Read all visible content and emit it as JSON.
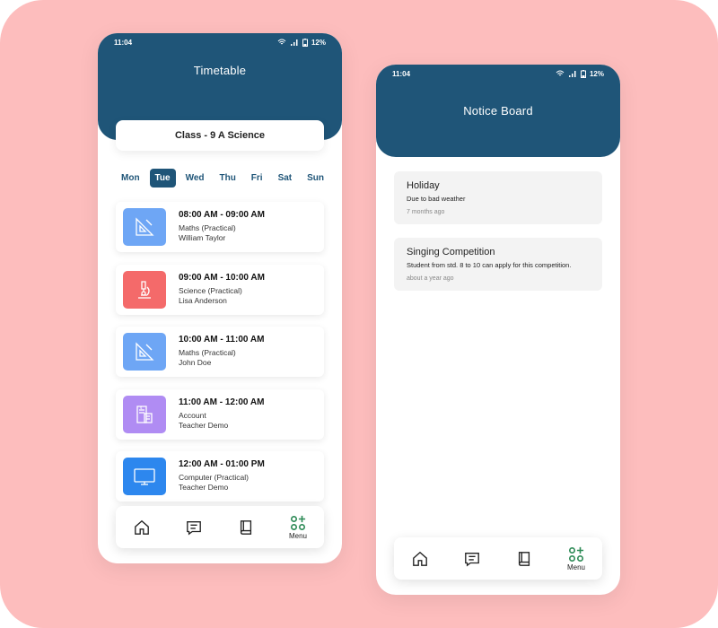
{
  "status_bar": {
    "time": "11:04",
    "battery": "12%"
  },
  "timetable": {
    "title": "Timetable",
    "class_name": "Class - 9 A Science",
    "days": [
      "Mon",
      "Tue",
      "Wed",
      "Thu",
      "Fri",
      "Sat",
      "Sun"
    ],
    "selected_day": "Tue",
    "periods": [
      {
        "time": "08:00 AM - 09:00 AM",
        "subject": "Maths (Practical)",
        "teacher": "William Taylor",
        "icon": "ruler-triangle-icon",
        "color": "#6ea6f5"
      },
      {
        "time": "09:00 AM - 10:00 AM",
        "subject": "Science (Practical)",
        "teacher": "Lisa Anderson",
        "icon": "microscope-icon",
        "color": "#f46a6a"
      },
      {
        "time": "10:00 AM - 11:00 AM",
        "subject": "Maths (Practical)",
        "teacher": "John Doe",
        "icon": "ruler-triangle-icon",
        "color": "#6ea6f5"
      },
      {
        "time": "11:00 AM - 12:00 AM",
        "subject": "Account",
        "teacher": "Teacher Demo",
        "icon": "calculator-document-icon",
        "color": "#b08cf3"
      },
      {
        "time": "12:00 AM - 01:00 PM",
        "subject": "Computer (Practical)",
        "teacher": "Teacher Demo",
        "icon": "monitor-icon",
        "color": "#2d87ee"
      }
    ]
  },
  "notice_board": {
    "title": "Notice Board",
    "notices": [
      {
        "title": "Holiday",
        "body": "Due to bad weather",
        "time": "7 months ago"
      },
      {
        "title": "Singing Competition",
        "body": "Student from std. 8 to 10 can apply for this competition.",
        "time": "about a year ago"
      }
    ]
  },
  "bottom_nav": {
    "menu_label": "Menu"
  },
  "colors": {
    "header": "#1f5578",
    "background": "#fdbdbd",
    "menu_icon_accent": "#2e8b57"
  }
}
